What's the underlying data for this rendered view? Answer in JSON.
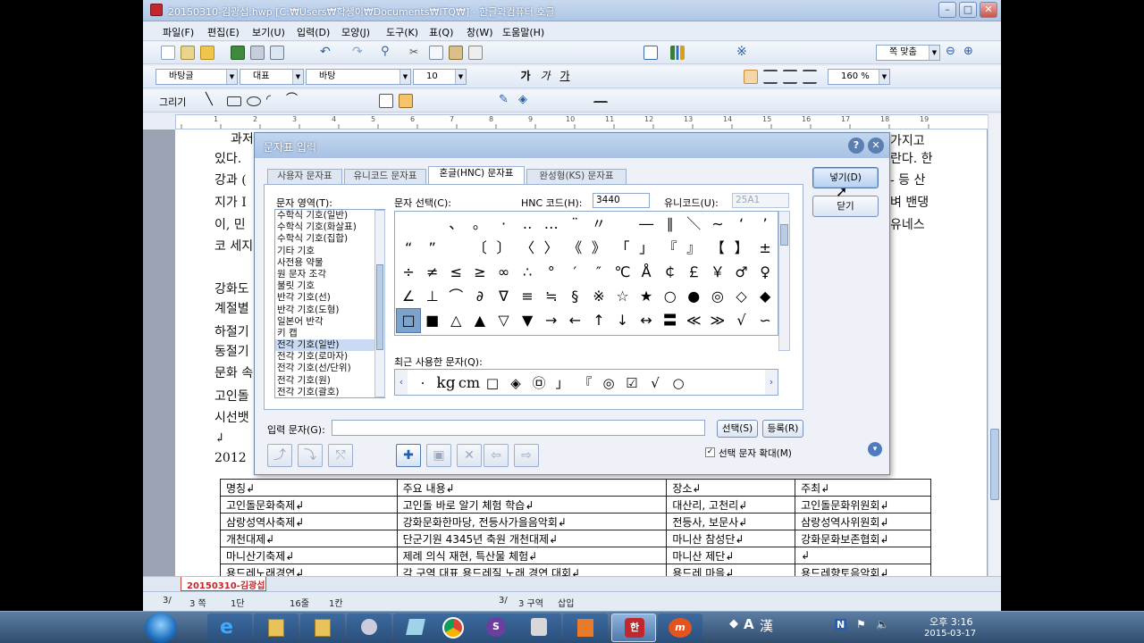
{
  "window": {
    "title": "20150310-김광섭.hwp [C:₩Users₩학생이₩Documents₩ITQ₩] - 한글과컴퓨터 호글",
    "controls": {
      "minimize": "–",
      "maximize": "□",
      "close": "✕"
    }
  },
  "menu": [
    "파일(F)",
    "편집(E)",
    "보기(U)",
    "입력(D)",
    "모양(J)",
    "도구(K)",
    "표(Q)",
    "창(W)",
    "도움말(H)"
  ],
  "format_toolbar": {
    "style": "바탕글",
    "font_type": "대표",
    "font_name": "바탕",
    "font_size": "10",
    "zoom": "160 %",
    "fit_page": "쪽 맞춤"
  },
  "draw_toolbar": {
    "label": "그리기"
  },
  "ruler": {
    "marks": [
      "1",
      "2",
      "3",
      "4",
      "5",
      "6",
      "7",
      "8",
      "9",
      "10",
      "11",
      "12",
      "13",
      "14",
      "15",
      "16",
      "17",
      "18",
      "19"
    ]
  },
  "document": {
    "lines_left": [
      "과저",
      "있다.",
      "강과 (",
      "지가 I",
      "이, 민",
      "코 세지",
      "강화도",
      "계절별",
      "하절기",
      "동절기",
      "문화 속",
      "고인돌",
      "시선뱃",
      "↲",
      "2012"
    ],
    "lines_right": [
      "가지고",
      "란다. 한",
      "- 등 산",
      "벼 밴댕",
      "유네스"
    ],
    "table": {
      "headers": [
        "명칭↲",
        "주요 내용↲",
        "장소↲",
        "주최↲"
      ],
      "rows": [
        [
          "고인돌문화축제↲",
          "고인돌 바로 알기 체험 학습↲",
          "대산리, 고천리↲",
          "고인돌문화위원회↲"
        ],
        [
          "삼랑성역사축제↲",
          "강화문화한마당, 전등사가을음악회↲",
          "전등사, 보문사↲",
          "삼랑성역사위원회↲"
        ],
        [
          "개천대제↲",
          "단군기원 4345년 축원 개천대제↲",
          "마니산 참성단↲",
          "강화문화보존협회↲"
        ],
        [
          "마니산기축제↲",
          "제례 의식 재현, 특산물 체험↲",
          "마니산 제단↲",
          "↲"
        ],
        [
          "용드레노래경연↲",
          "각 구역 대표 용드레질 노래 경연 대회↲",
          "용드레 마을↲",
          "용드레향토음악회↲"
        ]
      ]
    }
  },
  "dialog": {
    "title": "문자표 입력",
    "tabs": [
      "사용자 문자표",
      "유니코드 문자표",
      "혼글(HNC) 문자표",
      "완성형(KS) 문자표"
    ],
    "active_tab": "혼글(HNC) 문자표",
    "area_label": "문자 영역(T):",
    "select_label": "문자 선택(C):",
    "hnc_code_label": "HNC 코드(H):",
    "hnc_code_value": "3440",
    "unicode_label": "유니코드(U):",
    "unicode_value": "25A1",
    "areas": [
      "수학식 기호(일반)",
      "수학식 기호(화살표)",
      "수학식 기호(집합)",
      "기타 기호",
      "사전용 약물",
      "원 문자 조각",
      "불릿 기호",
      "반각 기호(선)",
      "반각 기호(도형)",
      "일본어 반각",
      "키 캡",
      "전각 기호(일반)",
      "전각 기호(로마자)",
      "전각 기호(선/단위)",
      "전각 기호(원)",
      "전각 기호(괄호)"
    ],
    "selected_area": "전각 기호(일반)",
    "chars": [
      [
        " ",
        " ",
        "、",
        "。",
        "·",
        "‥",
        "…",
        "¨",
        "〃",
        "­",
        "―",
        "∥",
        "＼",
        "∼",
        "‘",
        "’"
      ],
      [
        "“",
        "”",
        " ",
        "〔",
        "〕",
        "〈",
        "〉",
        "《",
        "》",
        "「",
        "」",
        "『",
        "』",
        "【",
        "】",
        "±",
        "×"
      ],
      [
        "÷",
        "≠",
        "≤",
        "≥",
        "∞",
        "∴",
        "°",
        "′",
        "″",
        "℃",
        "Å",
        "￠",
        "￡",
        "￥",
        "♂",
        "♀"
      ],
      [
        "∠",
        "⊥",
        "⌒",
        "∂",
        "∇",
        "≡",
        "≒",
        "§",
        "※",
        "☆",
        "★",
        "○",
        "●",
        "◎",
        "◇",
        "◆"
      ],
      [
        "□",
        "■",
        "△",
        "▲",
        "▽",
        "▼",
        "→",
        "←",
        "↑",
        "↓",
        "↔",
        "〓",
        "≪",
        "≫",
        "√",
        "∽"
      ]
    ],
    "recent_label": "최근 사용한 문자(Q):",
    "recent": [
      "·",
      "kg",
      "cm",
      "□",
      "◈",
      "㉤",
      "」",
      "『",
      "◎",
      "☑",
      "√",
      "○"
    ],
    "input_label": "입력 문자(G):",
    "input_value": "",
    "select_button": "선택(S)",
    "register_button": "등록(R)",
    "insert_button": "넣기(D)",
    "close_button": "닫기",
    "enlarge_label": "선택 문자 확대(M)",
    "enlarge_checked": true
  },
  "doc_tab": "20150310-김광섭",
  "status": {
    "page": "3/",
    "page_count": "3 쪽",
    "column": "1단",
    "line": "16줄",
    "col_pos": "1칸",
    "section": "3/",
    "section_name": "3 구역",
    "mode": "삽입"
  },
  "taskbar": {
    "lang_a": "A",
    "lang_han": "漢",
    "time": "오후 3:16",
    "date": "2015-03-17"
  },
  "colors": {
    "accent": "#4f79ad",
    "selection": "#c9daf2",
    "titlebar": "#aec6e6"
  }
}
